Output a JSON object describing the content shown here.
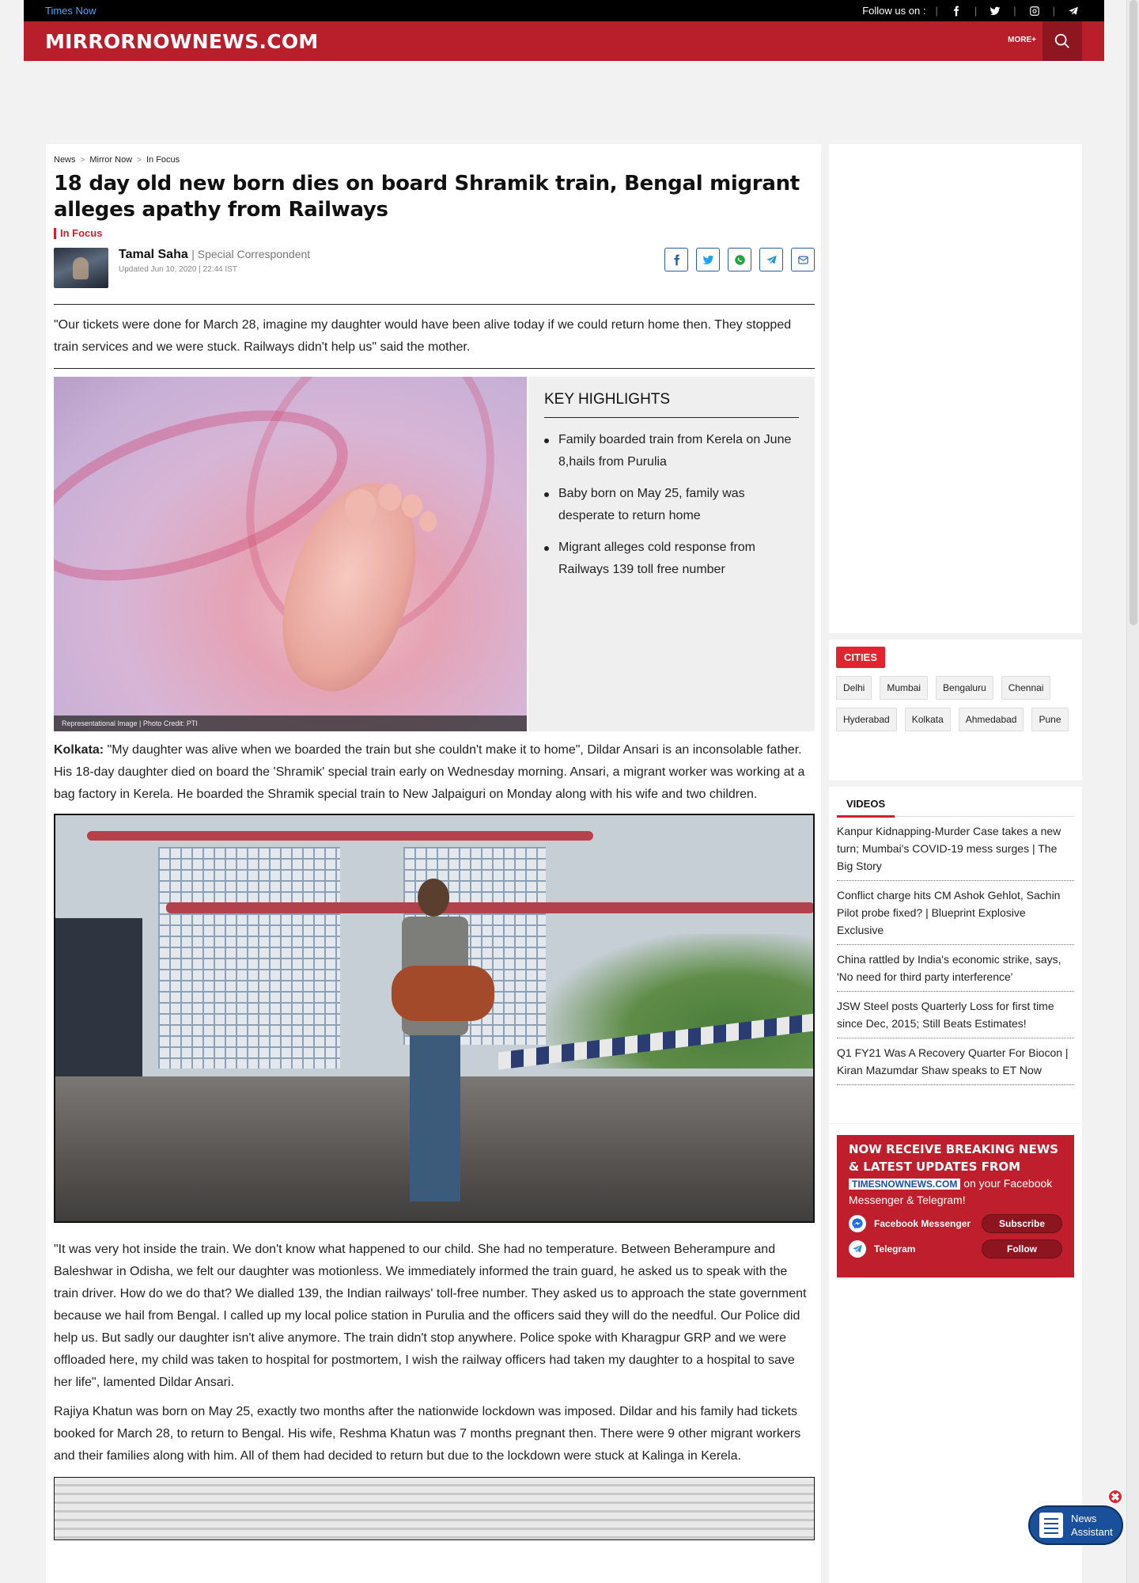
{
  "topbar": {
    "brand_link": "Times Now",
    "follow_label": "Follow us on :",
    "socials": [
      "facebook-icon",
      "twitter-icon",
      "instagram-icon",
      "telegram-icon"
    ]
  },
  "header": {
    "logo": "MIRRORNOWNEWS.COM",
    "more_label": "MORE+",
    "brand_color": "#b81f2b"
  },
  "breadcrumb": {
    "items": [
      "News",
      "Mirror Now",
      "In Focus"
    ],
    "separator": ">"
  },
  "article": {
    "title": "18 day old new born dies on board Shramik train, Bengal migrant alleges apathy from Railways",
    "section": "In Focus",
    "author_name": "Tamal Saha",
    "author_role": "| Special Correspondent",
    "updated": "Updated Jun 10, 2020 | 22:44 IST",
    "summary": "\"Our tickets were done for March 28, imagine my daughter would have been alive today if we could return home then. They stopped train services and we were stuck. Railways didn't help us\" said the mother.",
    "image_caption": "Representational Image  |  Photo Credit: PTI",
    "highlights_title": "KEY HIGHLIGHTS",
    "highlights": [
      "Family boarded train from Kerela on June 8,hails from Purulia",
      "Baby born on May 25, family was desperate to return home",
      "Migrant alleges cold response from Railways 139 toll free number"
    ],
    "dateline": "Kolkata:",
    "para1": " \"My daughter was alive when we boarded the train but she couldn't make it to home\", Dildar Ansari is an inconsolable father. His 18-day daughter died on board the 'Shramik' special train early on Wednesday morning. Ansari, a migrant worker was working at a bag factory in Kerela. He boarded the Shramik special train to New Jalpaiguri on Monday along with his wife and two children.",
    "para2": "\"It was very hot inside the train. We don't know what happened to our child. She had no temperature. Between Beherampure and Baleshwar in Odisha, we felt our daughter was motionless. We immediately informed the train guard, he asked us to speak with the train driver. How do we do that? We dialled 139, the Indian railways' toll-free number. They asked us to approach the state government because we hail from Bengal. I called up my local police station in Purulia and the officers said they will do the needful. Our Police did help us. But sadly our daughter isn't alive anymore. The train didn't stop anywhere. Police spoke with Kharagpur GRP and we were offloaded here, my child was taken to hospital for postmortem, I wish the railway officers had taken my daughter to a hospital to save her life\", lamented Dildar Ansari.",
    "para3": "Rajiya Khatun was born on May 25, exactly two months after the nationwide lockdown was imposed. Dildar and his family had tickets booked for March 28, to return to Bengal. His wife, Reshma Khatun was 7 months pregnant then. There were 9 other migrant workers and their families along with him. All of them had decided to return but due to the lockdown were stuck at Kalinga in Kerela."
  },
  "share_icons": [
    "facebook-icon",
    "twitter-icon",
    "whatsapp-icon",
    "telegram-icon",
    "mail-icon"
  ],
  "cities": {
    "label": "CITIES",
    "items": [
      "Delhi",
      "Mumbai",
      "Bengaluru",
      "Chennai",
      "Hyderabad",
      "Kolkata",
      "Ahmedabad",
      "Pune"
    ]
  },
  "videos": {
    "label": "VIDEOS",
    "items": [
      "Kanpur Kidnapping-Murder Case takes a new turn; Mumbai's COVID-19 mess surges | The Big Story",
      "Conflict charge hits CM Ashok Gehlot, Sachin Pilot probe fixed? | Blueprint Explosive Exclusive",
      "China rattled by India's economic strike, says, 'No need for third party interference'",
      "JSW Steel posts Quarterly Loss for first time since Dec, 2015; Still Beats Estimates!",
      "Q1 FY21 Was A Recovery Quarter For Biocon | Kiran Mazumdar Shaw speaks to ET Now"
    ]
  },
  "promo": {
    "headline": "NOW RECEIVE BREAKING NEWS & LATEST UPDATES FROM",
    "site": "TIMESNOWNEWS.COM",
    "line": "on your Facebook Messenger & Telegram!",
    "messenger_label": "Facebook Messenger",
    "messenger_btn": "Subscribe",
    "telegram_label": "Telegram",
    "telegram_btn": "Follow"
  },
  "assistant": {
    "line1": "News",
    "line2": "Assistant",
    "close": "✖"
  }
}
